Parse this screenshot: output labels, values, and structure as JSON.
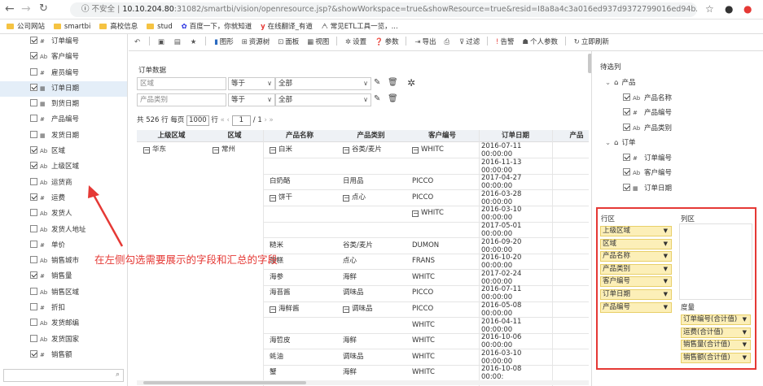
{
  "browser": {
    "security_label": "不安全",
    "url_host": "10.10.204.80",
    "url_rest": ":31082/smartbi/vision/openresource.jsp?&showWorkspace=true&showResource=true&resid=I8a8a4c3a016ed937d9372799016ed94b23bc02..."
  },
  "bookmarks": [
    {
      "label": "公司网站",
      "icon": "folder-icon"
    },
    {
      "label": "smartbi",
      "icon": "folder-icon"
    },
    {
      "label": "高校信息",
      "icon": "folder-icon"
    },
    {
      "label": "stud",
      "icon": "folder-icon"
    },
    {
      "label": "百度一下，你就知道",
      "icon": "baidu-icon"
    },
    {
      "label": "在线翻译_有道",
      "icon": "youdao-icon"
    },
    {
      "label": "常见ETL工具一览，...",
      "icon": "etl-icon"
    }
  ],
  "fields": [
    {
      "label": "订单编号",
      "type": "#",
      "checked": true
    },
    {
      "label": "客户编号",
      "type": "Ab",
      "checked": true
    },
    {
      "label": "雇员编号",
      "type": "#",
      "checked": false
    },
    {
      "label": "订单日期",
      "type": "▦",
      "checked": true,
      "selected": true
    },
    {
      "label": "到货日期",
      "type": "▦",
      "checked": false
    },
    {
      "label": "产品编号",
      "type": "#",
      "checked": false
    },
    {
      "label": "发货日期",
      "type": "▦",
      "checked": false
    },
    {
      "label": "区域",
      "type": "Ab",
      "checked": true
    },
    {
      "label": "上级区域",
      "type": "Ab",
      "checked": true
    },
    {
      "label": "运货商",
      "type": "Ab",
      "checked": false
    },
    {
      "label": "运费",
      "type": "#",
      "checked": true
    },
    {
      "label": "发货人",
      "type": "Ab",
      "checked": false
    },
    {
      "label": "发货人地址",
      "type": "Ab",
      "checked": false
    },
    {
      "label": "单价",
      "type": "#",
      "checked": false
    },
    {
      "label": "销售城市",
      "type": "Ab",
      "checked": false
    },
    {
      "label": "销售量",
      "type": "#",
      "checked": true
    },
    {
      "label": "销售区域",
      "type": "Ab",
      "checked": false
    },
    {
      "label": "折扣",
      "type": "#",
      "checked": false
    },
    {
      "label": "发货邮编",
      "type": "Ab",
      "checked": false
    },
    {
      "label": "发货国家",
      "type": "Ab",
      "checked": false
    },
    {
      "label": "销售额",
      "type": "#",
      "checked": true
    }
  ],
  "toolbar": {
    "items": [
      "图形",
      "资源树",
      "面板",
      "视图",
      "设置",
      "参数",
      "导出",
      "过滤",
      "告警",
      "个人参数",
      "立即刷新"
    ]
  },
  "panel": {
    "title": "订单数据",
    "filters": [
      {
        "field": "区域",
        "op": "等于",
        "value": "全部"
      },
      {
        "field": "产品类别",
        "op": "等于",
        "value": "全部"
      }
    ],
    "pager": {
      "total": "共 526 行",
      "per_page_label": "每页",
      "per_page": "1000",
      "row_unit": "行",
      "page": "1",
      "page_total": "/ 1"
    }
  },
  "table": {
    "headers": [
      "上级区域",
      "区域",
      "产品名称",
      "产品类别",
      "客户编号",
      "订单日期",
      "产品"
    ],
    "rows": [
      {
        "c0": "华东",
        "c1": "常州",
        "c2": "白米",
        "c3": "谷类/麦片",
        "c4": "WHITC",
        "c5": "2016-07-11 00:00:00"
      },
      {
        "c5": "2016-11-13 00:00:00"
      },
      {
        "c2": "白奶酪",
        "c3": "日用品",
        "c4": "PICCO",
        "c5": "2017-04-27 00:00:00"
      },
      {
        "c2": "饼干",
        "c3": "点心",
        "c4": "PICCO",
        "c5": "2016-03-28 00:00:00"
      },
      {
        "c4": "WHITC",
        "c5": "2016-03-10 00:00:00"
      },
      {
        "c5": "2017-05-01 00:00:00"
      },
      {
        "c2": "糙米",
        "c3": "谷类/麦片",
        "c4": "DUMON",
        "c5": "2016-09-20 00:00:00"
      },
      {
        "c2": "蛋糕",
        "c3": "点心",
        "c4": "FRANS",
        "c5": "2016-10-20 00:00:00"
      },
      {
        "c2": "海参",
        "c3": "海鲜",
        "c4": "WHITC",
        "c5": "2017-02-24 00:00:00"
      },
      {
        "c2": "海苔酱",
        "c3": "调味品",
        "c4": "PICCO",
        "c5": "2016-07-11 00:00:00"
      },
      {
        "c2": "海鲜酱",
        "c3": "调味品",
        "c4": "PICCO",
        "c5": "2016-05-08 00:00:00"
      },
      {
        "c4": "WHITC",
        "c5": "2016-04-11 00:00:00"
      },
      {
        "c2": "海哲皮",
        "c3": "海鲜",
        "c4": "WHITC",
        "c5": "2016-10-06 00:00:00"
      },
      {
        "c2": "蚝油",
        "c3": "调味品",
        "c4": "WHITC",
        "c5": "2016-03-10 00:00:00"
      },
      {
        "c2": "蟹",
        "c3": "海鲜",
        "c4": "WHITC",
        "c5": "2016-10-08 00:00:"
      }
    ]
  },
  "right_panel": {
    "title": "待选列",
    "groups": [
      {
        "name": "产品",
        "items": [
          "产品名称",
          "产品编号",
          "产品类别"
        ],
        "types": [
          "Ab",
          "#",
          "Ab"
        ]
      },
      {
        "name": "订单",
        "items": [
          "订单编号",
          "客户编号",
          "订单日期"
        ],
        "types": [
          "#",
          "Ab",
          "▦"
        ]
      }
    ],
    "row_zone_title": "行区",
    "col_zone_title": "列区",
    "measure_title": "度量",
    "row_fields": [
      "上级区域",
      "区域",
      "产品名称",
      "产品类别",
      "客户编号",
      "订单日期",
      "产品编号"
    ],
    "measures": [
      "订单编号(合计值)",
      "运费(合计值)",
      "销售量(合计值)",
      "销售额(合计值)"
    ]
  },
  "annotation": "在左侧勾选需要展示的字段和汇总的字段"
}
